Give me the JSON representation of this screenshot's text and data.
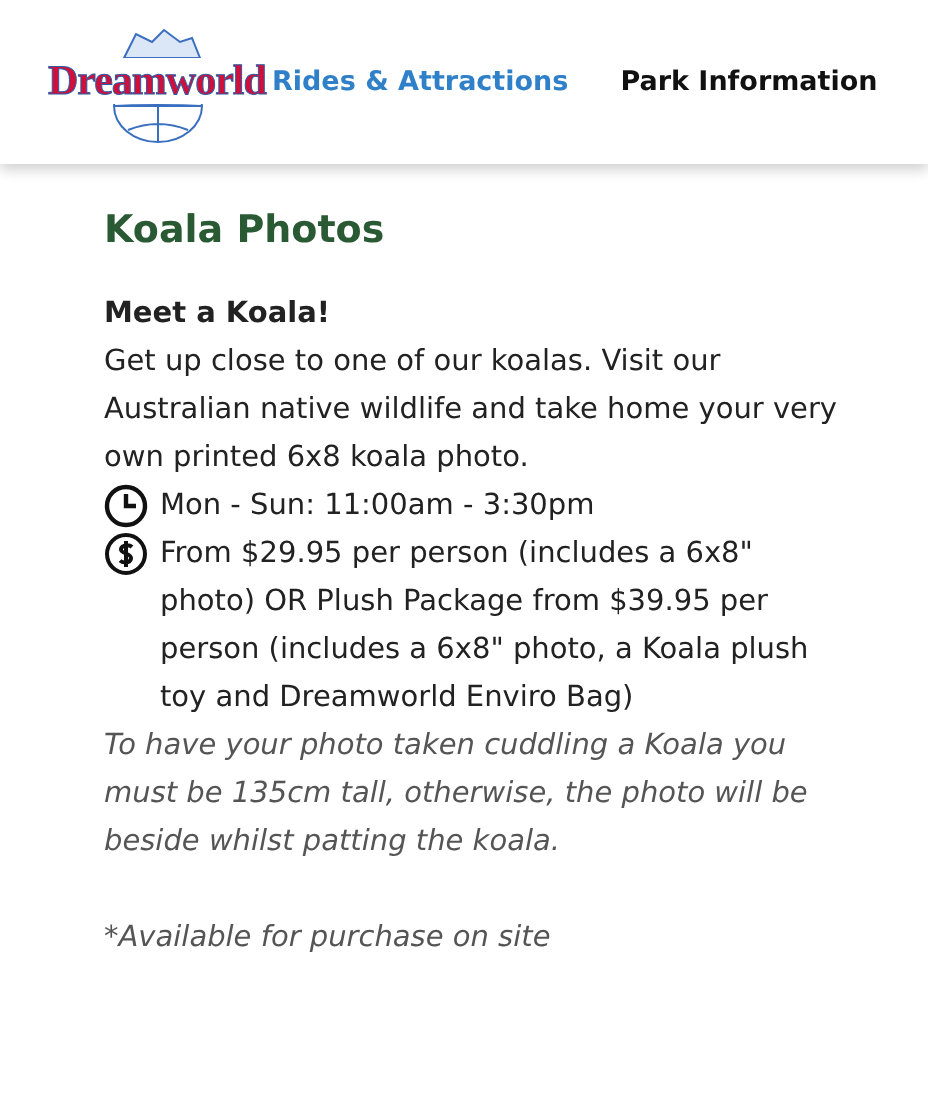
{
  "header": {
    "logo": "Dreamworld",
    "nav": [
      {
        "label": "Rides & Attractions",
        "selected": true
      },
      {
        "label": "Park Information",
        "selected": false
      }
    ]
  },
  "content": {
    "title": "Koala Photos",
    "subtitle": "Meet a Koala!",
    "intro": "Get up close to one of our koalas. Visit our Australian native wildlife and take home your very own printed 6x8 koala photo.",
    "details": [
      {
        "kind": "clock",
        "text": "Mon - Sun: 11:00am - 3:30pm"
      },
      {
        "kind": "dollar",
        "text": "From $29.95 per person (includes a 6x8\" photo) OR Plush Package from $39.95 per person  (includes a 6x8\" photo, a Koala plush toy and Dreamworld Enviro Bag)"
      }
    ],
    "note": "To have your photo taken cuddling a Koala you must be 135cm tall, otherwise, the photo will be beside whilst patting the koala.",
    "footnote": "*Available for purchase on site"
  }
}
